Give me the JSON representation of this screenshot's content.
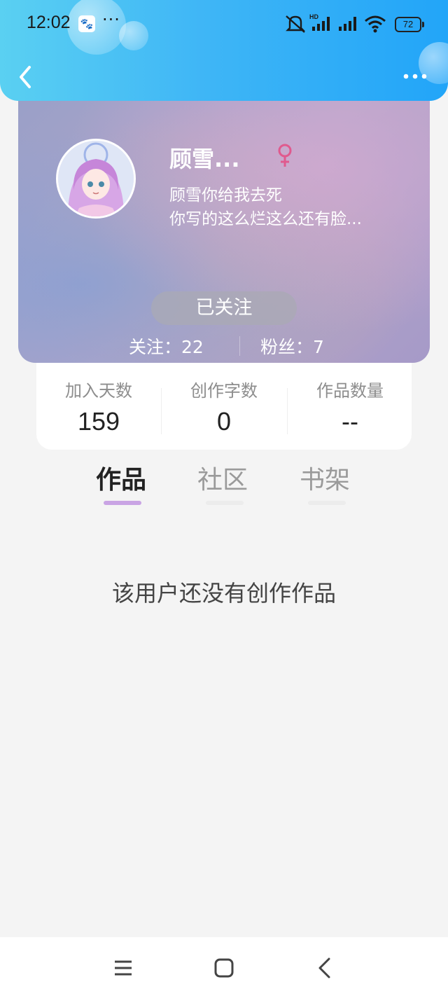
{
  "status_bar": {
    "time": "12:02",
    "overflow": "···",
    "battery": "72",
    "icons": [
      "baidu-app-icon",
      "mute-icon",
      "hd-signal-icon",
      "signal-icon",
      "wifi-icon",
      "battery-icon"
    ]
  },
  "header": {
    "back_icon": "chevron-left-icon",
    "more_icon": "more-dots-icon",
    "accent": "#2aa8f7"
  },
  "profile": {
    "name": "顾雪...",
    "gender": "female",
    "gender_color": "#e05a8e",
    "bio_line1": "顾雪你给我去死",
    "bio_line2": "你写的这么烂这么还有脸...",
    "follow_button": "已关注",
    "following_label": "关注：22",
    "followers_label": "粉丝：7"
  },
  "stats": [
    {
      "label": "加入天数",
      "value": "159"
    },
    {
      "label": "创作字数",
      "value": "0"
    },
    {
      "label": "作品数量",
      "value": "--"
    }
  ],
  "tabs": [
    {
      "label": "作品",
      "active": true
    },
    {
      "label": "社区",
      "active": false
    },
    {
      "label": "书架",
      "active": false
    }
  ],
  "empty_message": "该用户还没有创作作品",
  "nav": [
    "menu-icon",
    "home-square-icon",
    "back-triangle-icon"
  ]
}
